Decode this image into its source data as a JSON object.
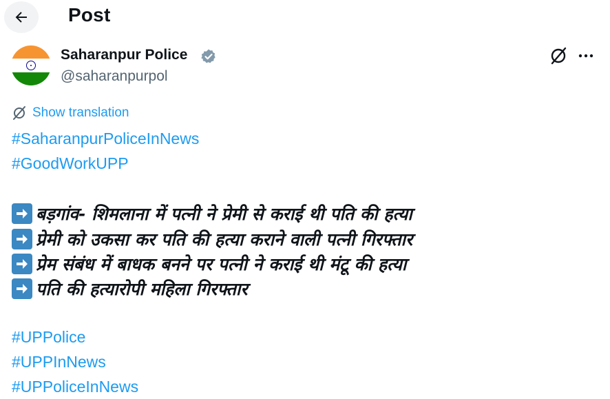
{
  "header": {
    "title": "Post"
  },
  "author": {
    "name": "Saharanpur Police",
    "handle": "@saharanpurpol",
    "avatar_colors": [
      "#f79432",
      "#ffffff",
      "#138808"
    ],
    "verified_color": "#829aab"
  },
  "post": {
    "translate_label": "Show translation",
    "hashtags_top": [
      "#SaharanpurPoliceInNews",
      "#GoodWorkUPP"
    ],
    "lines": [
      "बड़गांव- शिमलाना में पत्नी ने प्रेमी से कराई थी पति की हत्या",
      "प्रेमी को उकसा कर पति की हत्या कराने वाली पत्नी गिरफ्तार",
      "प्रेम संबंध में बाधक बनने पर पत्नी ने कराई थी मंटू की हत्या",
      "पति की हत्यारोपी महिला गिरफ्तार"
    ],
    "hashtags_bottom": [
      "#UPPolice",
      "#UPPInNews",
      "#UPPoliceInNews"
    ]
  },
  "colors": {
    "link": "#1d9bf0",
    "text": "#0f1419",
    "muted": "#536471",
    "arrow_box": "#3b88c3"
  },
  "icons": [
    "back-arrow-icon",
    "verified-badge-icon",
    "grok-icon",
    "more-icon",
    "translate-icon",
    "right-arrow-icon"
  ]
}
